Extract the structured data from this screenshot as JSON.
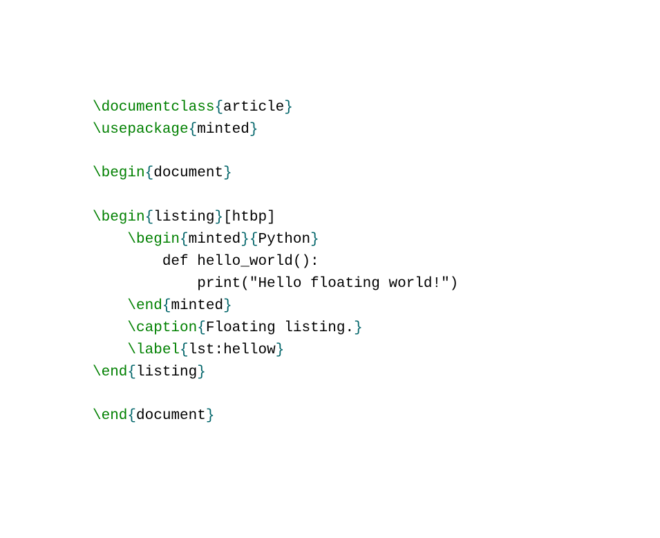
{
  "lines": [
    [
      {
        "class": "cmd",
        "text": "\\documentclass"
      },
      {
        "class": "brace",
        "text": "{"
      },
      {
        "class": "txt",
        "text": "article"
      },
      {
        "class": "brace",
        "text": "}"
      }
    ],
    [
      {
        "class": "cmd",
        "text": "\\usepackage"
      },
      {
        "class": "brace",
        "text": "{"
      },
      {
        "class": "txt",
        "text": "minted"
      },
      {
        "class": "brace",
        "text": "}"
      }
    ],
    [],
    [
      {
        "class": "cmd",
        "text": "\\begin"
      },
      {
        "class": "brace",
        "text": "{"
      },
      {
        "class": "txt",
        "text": "document"
      },
      {
        "class": "brace",
        "text": "}"
      }
    ],
    [],
    [
      {
        "class": "cmd",
        "text": "\\begin"
      },
      {
        "class": "brace",
        "text": "{"
      },
      {
        "class": "txt",
        "text": "listing"
      },
      {
        "class": "brace",
        "text": "}"
      },
      {
        "class": "txt",
        "text": "[htbp]"
      }
    ],
    [
      {
        "class": "txt",
        "text": "    "
      },
      {
        "class": "cmd",
        "text": "\\begin"
      },
      {
        "class": "brace",
        "text": "{"
      },
      {
        "class": "txt",
        "text": "minted"
      },
      {
        "class": "brace",
        "text": "}{"
      },
      {
        "class": "txt",
        "text": "Python"
      },
      {
        "class": "brace",
        "text": "}"
      }
    ],
    [
      {
        "class": "txt",
        "text": "        def hello_world():"
      }
    ],
    [
      {
        "class": "txt",
        "text": "            print(\"Hello floating world!\")"
      }
    ],
    [
      {
        "class": "txt",
        "text": "    "
      },
      {
        "class": "cmd",
        "text": "\\end"
      },
      {
        "class": "brace",
        "text": "{"
      },
      {
        "class": "txt",
        "text": "minted"
      },
      {
        "class": "brace",
        "text": "}"
      }
    ],
    [
      {
        "class": "txt",
        "text": "    "
      },
      {
        "class": "cmd",
        "text": "\\caption"
      },
      {
        "class": "brace",
        "text": "{"
      },
      {
        "class": "txt",
        "text": "Floating listing."
      },
      {
        "class": "brace",
        "text": "}"
      }
    ],
    [
      {
        "class": "txt",
        "text": "    "
      },
      {
        "class": "cmd",
        "text": "\\label"
      },
      {
        "class": "brace",
        "text": "{"
      },
      {
        "class": "txt",
        "text": "lst:hellow"
      },
      {
        "class": "brace",
        "text": "}"
      }
    ],
    [
      {
        "class": "cmd",
        "text": "\\end"
      },
      {
        "class": "brace",
        "text": "{"
      },
      {
        "class": "txt",
        "text": "listing"
      },
      {
        "class": "brace",
        "text": "}"
      }
    ],
    [],
    [
      {
        "class": "cmd",
        "text": "\\end"
      },
      {
        "class": "brace",
        "text": "{"
      },
      {
        "class": "txt",
        "text": "document"
      },
      {
        "class": "brace",
        "text": "}"
      }
    ]
  ]
}
